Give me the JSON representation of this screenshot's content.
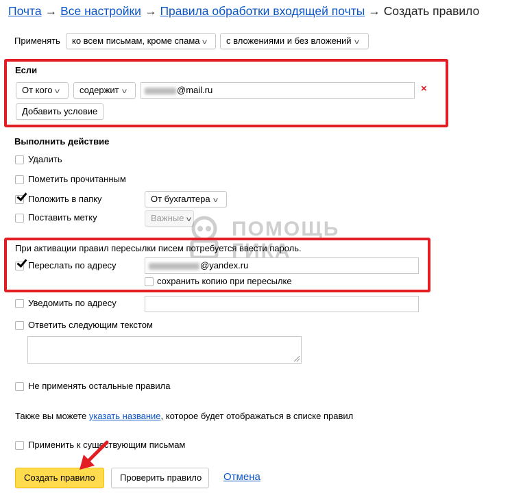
{
  "breadcrumbs": {
    "items": [
      "Почта",
      "Все настройки",
      "Правила обработки входящей почты"
    ],
    "separator": "→",
    "current": "Создать правило"
  },
  "apply": {
    "label": "Применять",
    "scope": "ко всем письмам, кроме спама",
    "attachments": "с вложениями и без вложений"
  },
  "condition": {
    "heading": "Если",
    "field": "От кого",
    "operator": "содержит",
    "value_suffix": "@mail.ru",
    "add_button": "Добавить условие",
    "remove_icon": "×"
  },
  "actions": {
    "heading": "Выполнить действие",
    "delete": "Удалить",
    "mark_read": "Пометить прочитанным",
    "move_to_folder": "Положить в папку",
    "folder_value": "От бухгалтера",
    "set_label": "Поставить метку",
    "label_value": "Важные",
    "forward_notice": "При активации правил пересылки писем потребуется ввести пароль.",
    "forward_to": "Переслать по адресу",
    "forward_value_suffix": "@yandex.ru",
    "keep_copy": "сохранить копию при пересылке",
    "notify": "Уведомить по адресу",
    "reply_text": "Ответить следующим текстом",
    "stop_rules": "Не применять остальные правила"
  },
  "name_hint": {
    "before": "Также вы можете ",
    "link": "указать название",
    "after": ", которое будет отображаться в списке правил"
  },
  "apply_existing": "Применить к существующим письмам",
  "buttons": {
    "create": "Создать правило",
    "check": "Проверить правило",
    "cancel": "Отмена"
  },
  "watermark": {
    "line1": "ПОМОЩЬ",
    "line2": "ГИКА",
    "line3": "GEEK-HELP.RU"
  },
  "colors": {
    "link": "#0b55c7",
    "highlight": "#e31d24",
    "primary_button": "#ffdb4d"
  }
}
